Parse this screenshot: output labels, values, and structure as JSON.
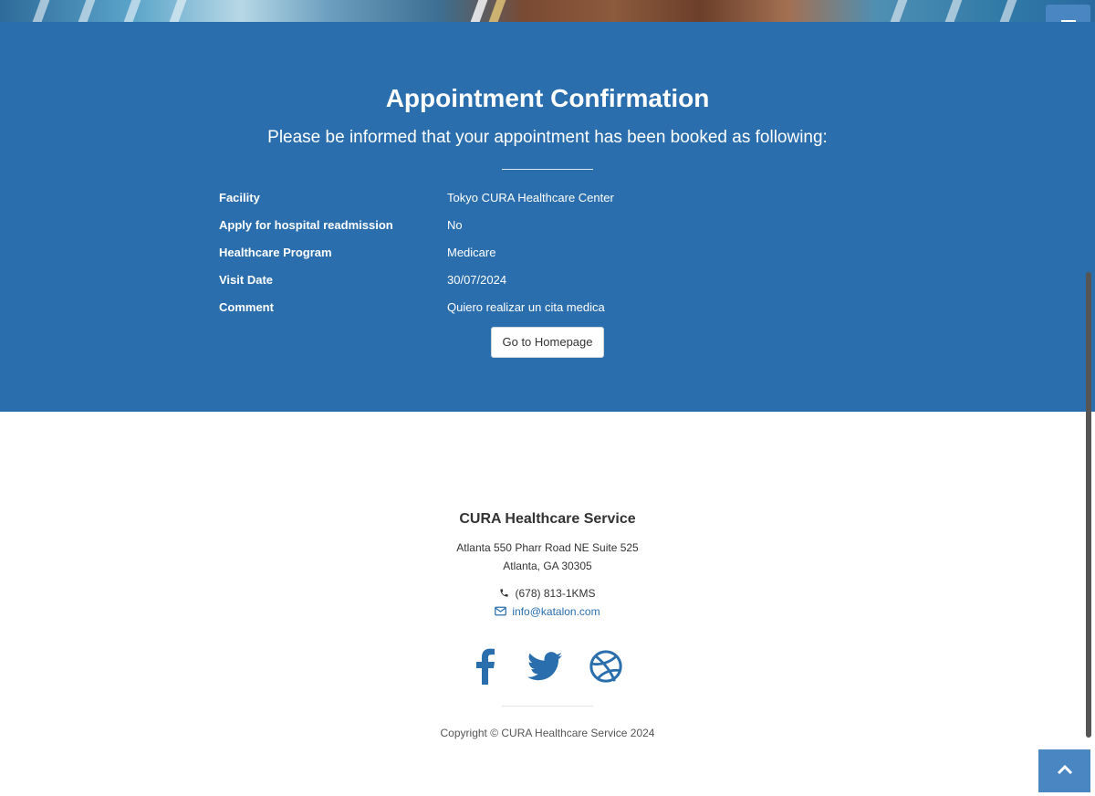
{
  "page": {
    "title": "Appointment Confirmation",
    "subtitle": "Please be informed that your appointment has been booked as following:"
  },
  "appointment": {
    "rows": [
      {
        "label": "Facility",
        "value": "Tokyo CURA Healthcare Center"
      },
      {
        "label": "Apply for hospital readmission",
        "value": "No"
      },
      {
        "label": "Healthcare Program",
        "value": "Medicare"
      },
      {
        "label": "Visit Date",
        "value": "30/07/2024"
      },
      {
        "label": "Comment",
        "value": "Quiero realizar un cita medica"
      }
    ]
  },
  "buttons": {
    "home_label": "Go to Homepage"
  },
  "icons": {
    "menu": "bars-icon",
    "phone": "phone-icon",
    "email": "envelope-icon",
    "facebook": "facebook-icon",
    "twitter": "twitter-icon",
    "dribbble": "dribbble-icon",
    "to_top": "chevron-up-icon"
  },
  "footer": {
    "company": "CURA Healthcare Service",
    "address_line1": "Atlanta 550 Pharr Road NE Suite 525",
    "address_line2": "Atlanta, GA 30305",
    "phone": "(678) 813-1KMS",
    "email": "info@katalon.com",
    "copyright": "Copyright © CURA Healthcare Service 2024"
  },
  "colors": {
    "primary": "#2a6ead",
    "accent": "#4a86c2"
  }
}
